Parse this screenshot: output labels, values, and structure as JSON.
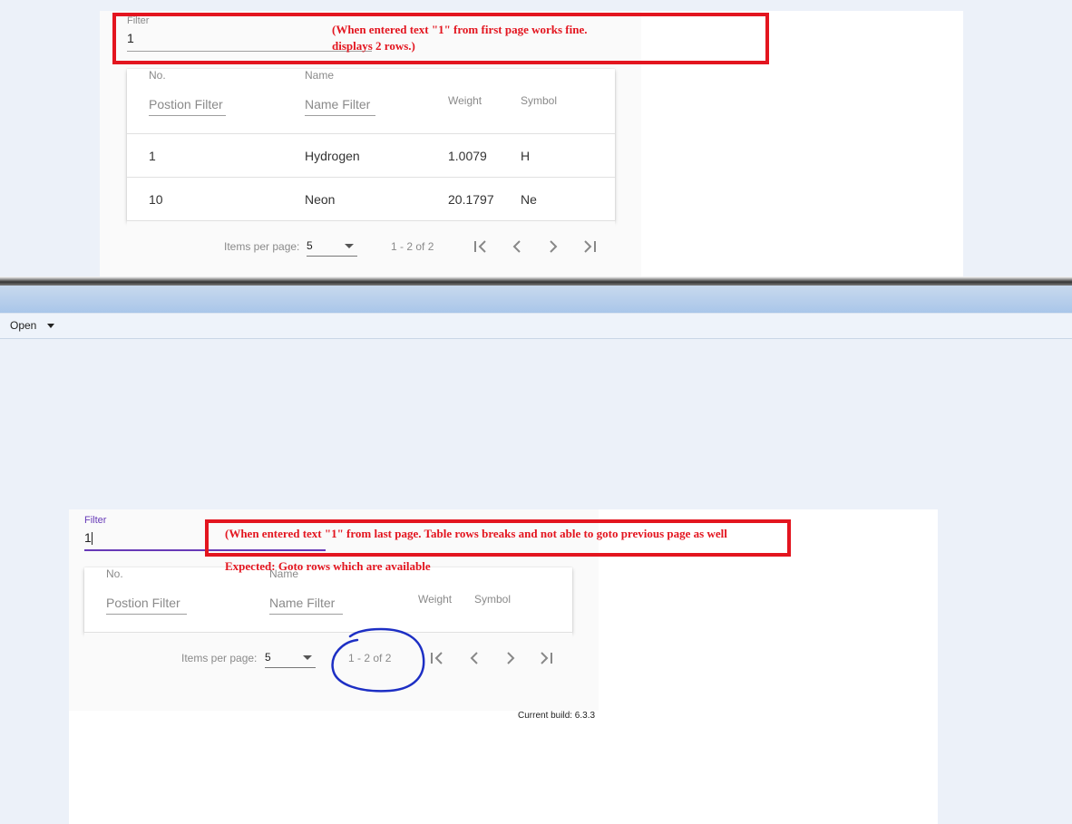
{
  "top": {
    "filter_label": "Filter",
    "filter_value": "1",
    "annotation": {
      "line1": "(When entered text \"1\" from first page works fine.",
      "line2": "displays 2 rows.)"
    },
    "table": {
      "headers": {
        "no": "No.",
        "name": "Name",
        "weight": "Weight",
        "symbol": "Symbol"
      },
      "position_filter": "Postion Filter",
      "name_filter": "Name Filter",
      "rows": [
        {
          "no": "1",
          "name": "Hydrogen",
          "weight": "1.0079",
          "symbol": "H"
        },
        {
          "no": "10",
          "name": "Neon",
          "weight": "20.1797",
          "symbol": "Ne"
        }
      ]
    },
    "paginator": {
      "items_per_page_label": "Items per page:",
      "page_size": "5",
      "range": "1 - 2 of 2"
    }
  },
  "toolbar": {
    "open_label": "Open"
  },
  "bottom": {
    "filter_label": "Filter",
    "filter_value": "1",
    "annotation": {
      "line1": "(When entered text \"1\" from last page. Table rows breaks and not able to goto previous page as well",
      "line2": "Expected: Goto rows which are available"
    },
    "table": {
      "headers": {
        "no": "No.",
        "name": "Name",
        "weight": "Weight",
        "symbol": "Symbol"
      },
      "position_filter": "Postion Filter",
      "name_filter": "Name Filter"
    },
    "paginator": {
      "items_per_page_label": "Items per page:",
      "page_size": "5",
      "range": "1 - 2 of 2"
    },
    "build_info": "Current build: 6.3.3"
  },
  "colors": {
    "annotation_red": "#e3151f",
    "circle_blue": "#1d2fc4",
    "focus_purple": "#673ab7",
    "background": "#ecf1f9"
  },
  "icons": [
    "first-page-icon",
    "previous-page-icon",
    "next-page-icon",
    "last-page-icon",
    "dropdown-arrow-icon"
  ]
}
